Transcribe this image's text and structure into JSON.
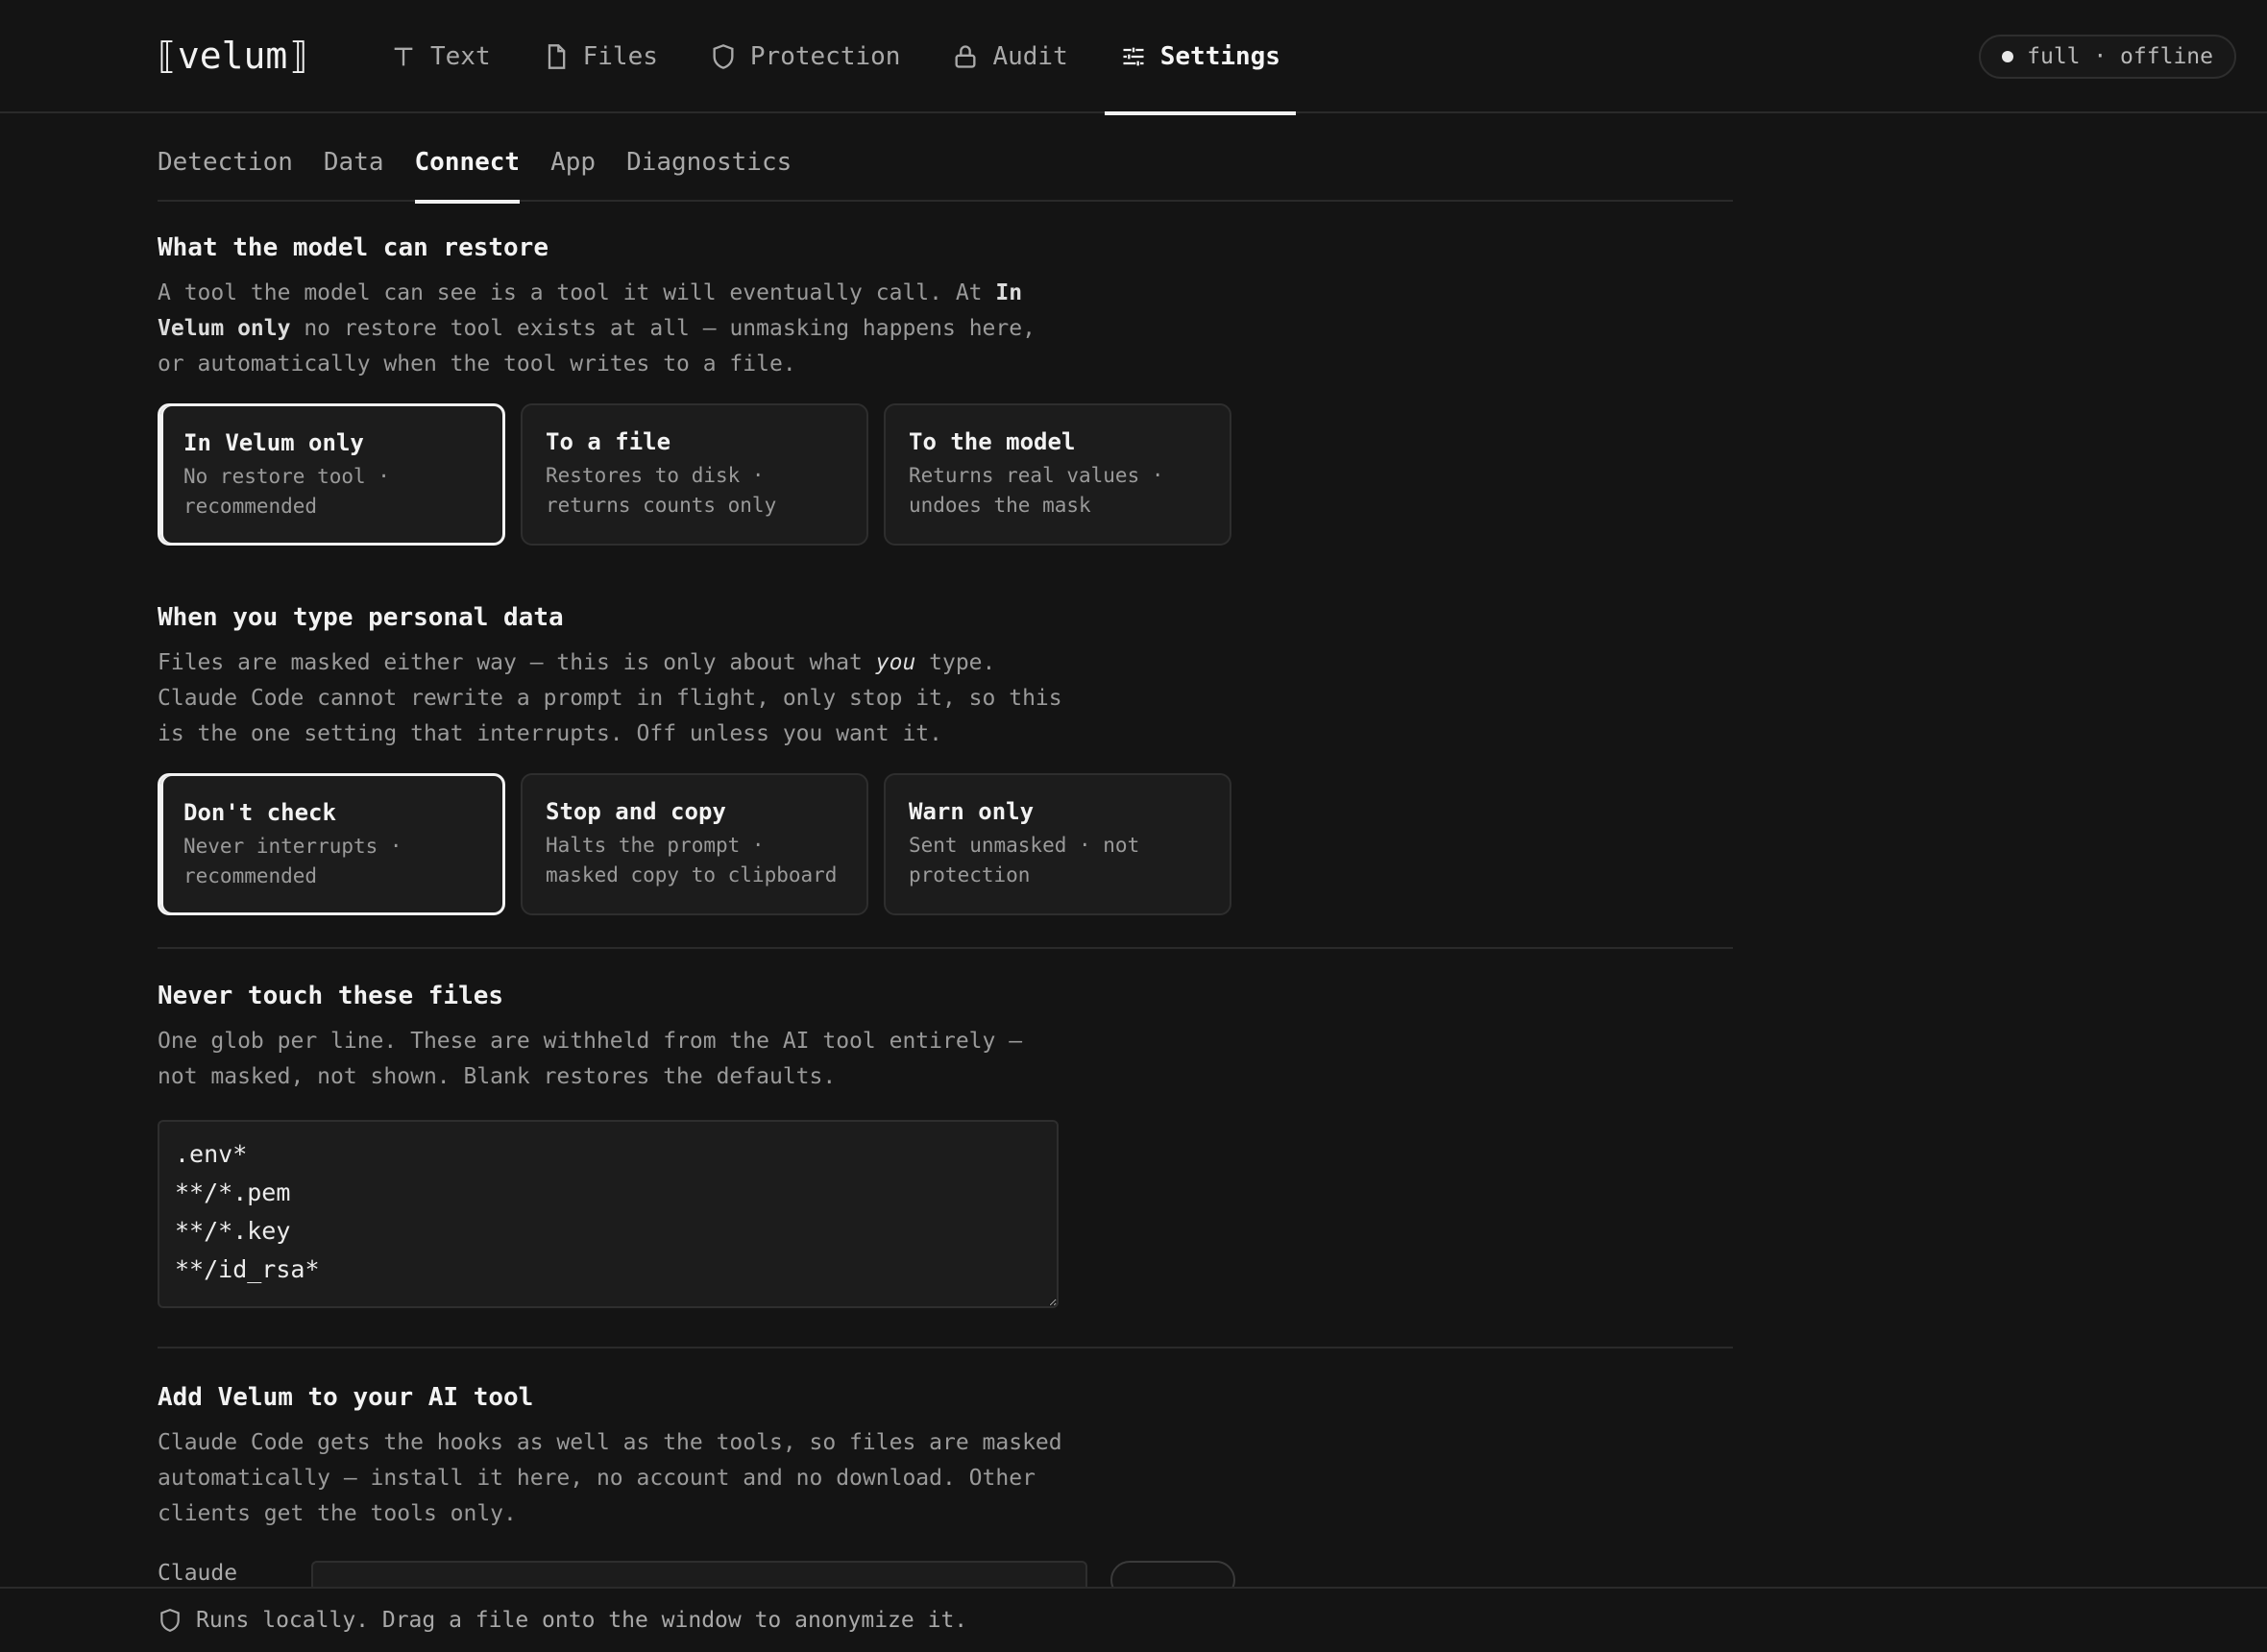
{
  "app": {
    "logo": "⟦velum⟧",
    "nav": [
      {
        "label": "Text",
        "icon": "text-icon"
      },
      {
        "label": "Files",
        "icon": "file-icon"
      },
      {
        "label": "Protection",
        "icon": "shield-icon"
      },
      {
        "label": "Audit",
        "icon": "lock-icon"
      },
      {
        "label": "Settings",
        "icon": "sliders-icon",
        "active": true
      }
    ],
    "status": "full · offline"
  },
  "subtabs": [
    {
      "label": "Detection"
    },
    {
      "label": "Data"
    },
    {
      "label": "Connect",
      "active": true
    },
    {
      "label": "App"
    },
    {
      "label": "Diagnostics"
    }
  ],
  "restore": {
    "title": "What the model can restore",
    "desc_1": "A tool the model can see is a tool it will eventually call. At ",
    "desc_bold": "In Velum only",
    "desc_2": " no restore tool exists at all — unmasking happens here, or automatically when the tool writes to a file.",
    "options": [
      {
        "title": "In Velum only",
        "sub": "No restore tool · recommended",
        "selected": true
      },
      {
        "title": "To a file",
        "sub": "Restores to disk · returns counts only"
      },
      {
        "title": "To the model",
        "sub": "Returns real values · undoes the mask"
      }
    ]
  },
  "typing": {
    "title": "When you type personal data",
    "desc_1": "Files are masked either way — this is only about what ",
    "desc_em": "you",
    "desc_2": " type. Claude Code cannot rewrite a prompt in flight, only stop it, so this is the one setting that interrupts. Off unless you want it.",
    "options": [
      {
        "title": "Don't check",
        "sub": "Never interrupts · recommended",
        "selected": true
      },
      {
        "title": "Stop and copy",
        "sub": "Halts the prompt · masked copy to clipboard"
      },
      {
        "title": "Warn only",
        "sub": "Sent unmasked · not protection"
      }
    ]
  },
  "files": {
    "title": "Never touch these files",
    "desc": "One glob per line. These are withheld from the AI tool entirely — not masked, not shown. Blank restores the defaults.",
    "globs": ".env*\n**/*.pem\n**/*.key\n**/id_rsa*"
  },
  "addtool": {
    "title": "Add Velum to your AI tool",
    "desc": "Claude Code gets the hooks as well as the tools, so files are masked automatically — install it here, no account and no download. Other clients get the tools only.",
    "client_label": "Claude"
  },
  "footer": {
    "text": "Runs locally. Drag a file onto the window to anonymize it.",
    "icon": "shield-icon"
  }
}
